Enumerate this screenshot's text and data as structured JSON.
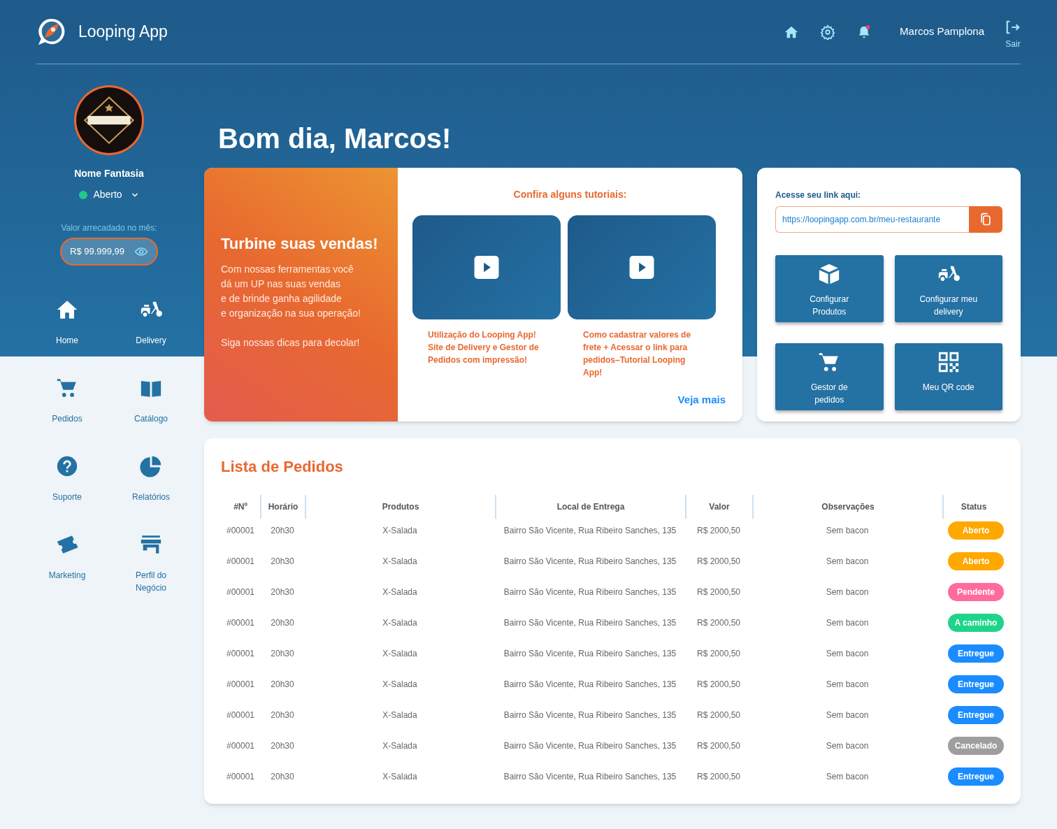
{
  "header": {
    "app_name": "Looping App",
    "user_name": "Marcos Pamplona",
    "logout_label": "Sair",
    "notification_unread": true
  },
  "profile": {
    "name": "Nome Fantasia",
    "status": "Aberto",
    "revenue_label": "Valor arrecadado no mês:",
    "revenue": "R$ 99.999,99"
  },
  "nav": [
    {
      "label": "Home"
    },
    {
      "label": "Delivery"
    },
    {
      "label": "Pedidos"
    },
    {
      "label": "Catálogo"
    },
    {
      "label": "Suporte"
    },
    {
      "label": "Relatórios"
    },
    {
      "label": "Marketing"
    },
    {
      "label": "Perfil do Negócio"
    }
  ],
  "greeting": "Bom dia, Marcos!",
  "promo": {
    "title": "Turbine suas vendas!",
    "lines": [
      "Com nossas ferramentas você",
      "dá um UP nas suas vendas",
      "e de brinde ganha agilidade",
      "e organização na sua operação!"
    ],
    "footer": "Siga nossas dicas para decolar!"
  },
  "tutorials": {
    "title": "Confira alguns tutoriais:",
    "videos": [
      {
        "caption": "Utilização do Looping App! Site de Delivery e Gestor de Pedidos com impressão!"
      },
      {
        "caption": "Como cadastrar valores de frete + Acessar o link para pedidos–Tutorial Looping App!"
      }
    ],
    "more": "Veja mais"
  },
  "link_panel": {
    "label": "Acesse seu link aqui:",
    "url": "https://loopingapp.com.br/meu-restaurante",
    "shortcuts": [
      {
        "label": "Configurar Produtos"
      },
      {
        "label": "Configurar meu delivery"
      },
      {
        "label": "Gestor de pedidos"
      },
      {
        "label": "Meu QR code"
      }
    ]
  },
  "orders": {
    "title": "Lista de Pedidos",
    "columns": [
      "#Nº",
      "Horário",
      "Produtos",
      "Local de Entrega",
      "Valor",
      "Observações",
      "Status"
    ],
    "rows": [
      {
        "cells": [
          "#00001",
          "20h30",
          "X-Salada",
          "Bairro São Vicente, Rua Ribeiro Sanches, 135",
          "R$ 2000,50",
          "Sem bacon"
        ],
        "status": "Aberto",
        "color": "#ffa800"
      },
      {
        "cells": [
          "#00001",
          "20h30",
          "X-Salada",
          "Bairro São Vicente, Rua Ribeiro Sanches, 135",
          "R$ 2000,50",
          "Sem bacon"
        ],
        "status": "Aberto",
        "color": "#ffa800"
      },
      {
        "cells": [
          "#00001",
          "20h30",
          "X-Salada",
          "Bairro São Vicente, Rua Ribeiro Sanches, 135",
          "R$ 2000,50",
          "Sem bacon"
        ],
        "status": "Pendente",
        "color": "#ff6b9a"
      },
      {
        "cells": [
          "#00001",
          "20h30",
          "X-Salada",
          "Bairro São Vicente, Rua Ribeiro Sanches, 135",
          "R$ 2000,50",
          "Sem bacon"
        ],
        "status": "A caminho",
        "color": "#1ed48a"
      },
      {
        "cells": [
          "#00001",
          "20h30",
          "X-Salada",
          "Bairro São Vicente, Rua Ribeiro Sanches, 135",
          "R$ 2000,50",
          "Sem bacon"
        ],
        "status": "Entregue",
        "color": "#1a8cff"
      },
      {
        "cells": [
          "#00001",
          "20h30",
          "X-Salada",
          "Bairro São Vicente, Rua Ribeiro Sanches, 135",
          "R$ 2000,50",
          "Sem bacon"
        ],
        "status": "Entregue",
        "color": "#1a8cff"
      },
      {
        "cells": [
          "#00001",
          "20h30",
          "X-Salada",
          "Bairro São Vicente, Rua Ribeiro Sanches, 135",
          "R$ 2000,50",
          "Sem bacon"
        ],
        "status": "Entregue",
        "color": "#1a8cff"
      },
      {
        "cells": [
          "#00001",
          "20h30",
          "X-Salada",
          "Bairro São Vicente, Rua Ribeiro Sanches, 135",
          "R$ 2000,50",
          "Sem bacon"
        ],
        "status": "Cancelado",
        "color": "#9e9e9e"
      },
      {
        "cells": [
          "#00001",
          "20h30",
          "X-Salada",
          "Bairro São Vicente, Rua Ribeiro Sanches, 135",
          "R$ 2000,50",
          "Sem bacon"
        ],
        "status": "Entregue",
        "color": "#1a8cff"
      }
    ]
  }
}
